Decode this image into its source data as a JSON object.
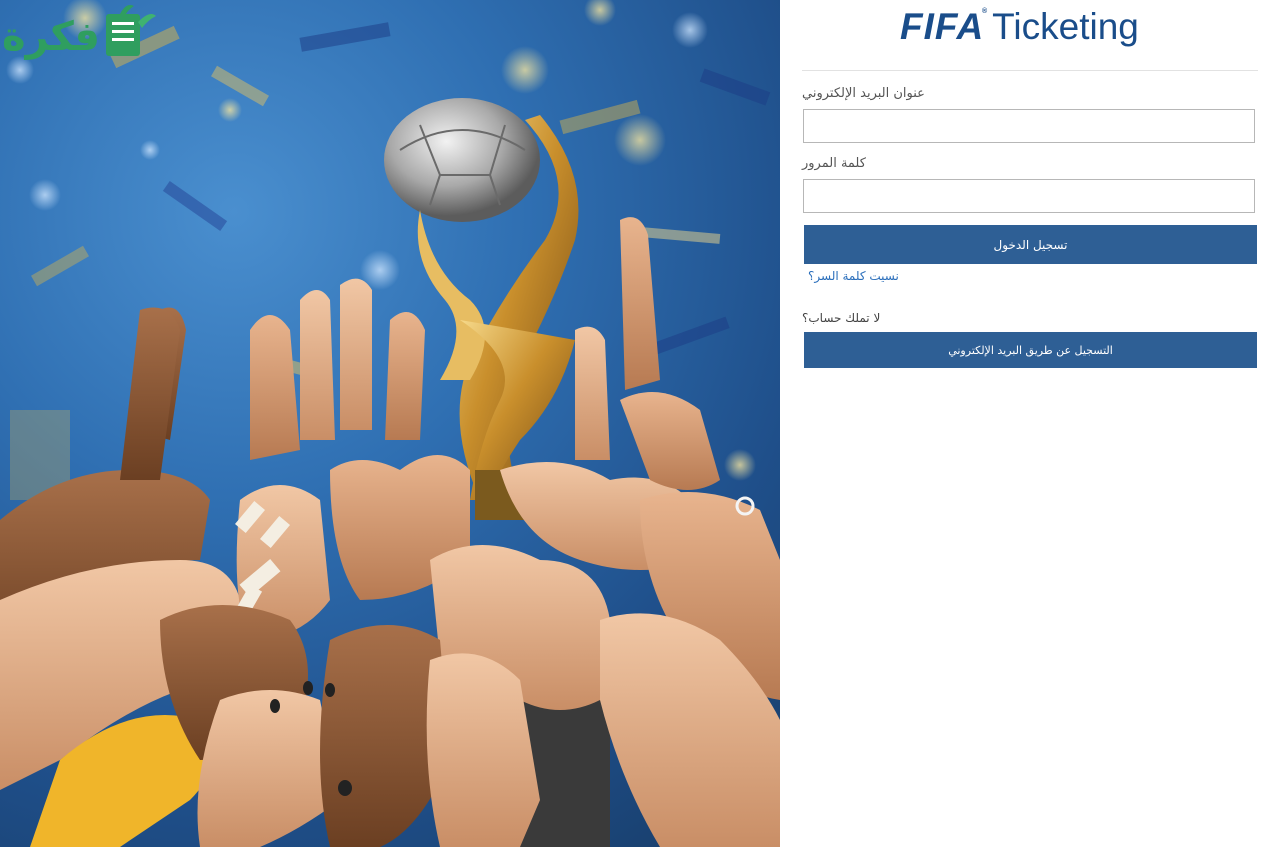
{
  "brand": {
    "logo_word": "FIFA",
    "logo_suffix": "Ticketing",
    "color": "#1a4d8a"
  },
  "login_form": {
    "email_label": "عنوان البريد الإلكتروني",
    "email_value": "",
    "password_label": "كلمة المرور",
    "password_value": "",
    "submit_label": "تسجيل الدخول",
    "forgot_password_link": "نسيت كلمة السر؟"
  },
  "register": {
    "prompt": "لا تملك حساب؟",
    "button_label": "التسجيل عن طريق البريد الإلكتروني"
  },
  "hero": {
    "subject": "trophy-with-raised-hands"
  },
  "watermark": {
    "text": "فكرة"
  },
  "colors": {
    "primary_button": "#2e5f95",
    "link": "#2a6ebb",
    "watermark": "#2f9e5f"
  }
}
